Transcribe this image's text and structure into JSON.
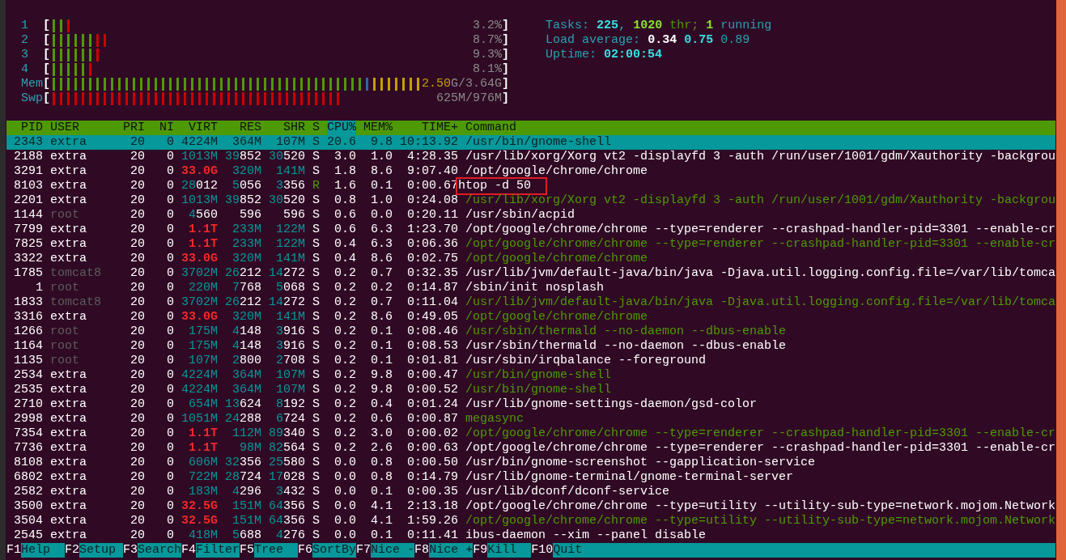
{
  "meters": [
    {
      "label": "1",
      "open": "[",
      "close": "]",
      "bars": [
        {
          "color": "#4e9a06"
        },
        {
          "color": "#4e9a06"
        },
        {
          "color": "#cc0000"
        }
      ],
      "reading": [
        {
          "text": "3.2%",
          "kind": "plain"
        }
      ]
    },
    {
      "label": "2",
      "open": "[",
      "close": "]",
      "bars": [
        {
          "color": "#4e9a06"
        },
        {
          "color": "#4e9a06"
        },
        {
          "color": "#4e9a06"
        },
        {
          "color": "#4e9a06"
        },
        {
          "color": "#4e9a06"
        },
        {
          "color": "#4e9a06"
        },
        {
          "color": "#cc0000"
        },
        {
          "color": "#cc0000"
        }
      ],
      "reading": [
        {
          "text": "8.7%",
          "kind": "plain"
        }
      ]
    },
    {
      "label": "3",
      "open": "[",
      "close": "]",
      "bars": [
        {
          "color": "#4e9a06"
        },
        {
          "color": "#4e9a06"
        },
        {
          "color": "#4e9a06"
        },
        {
          "color": "#4e9a06"
        },
        {
          "color": "#4e9a06"
        },
        {
          "color": "#4e9a06"
        },
        {
          "color": "#cc0000"
        }
      ],
      "reading": [
        {
          "text": "9.3%",
          "kind": "plain"
        }
      ]
    },
    {
      "label": "4",
      "open": "[",
      "close": "]",
      "bars": [
        {
          "color": "#4e9a06"
        },
        {
          "color": "#4e9a06"
        },
        {
          "color": "#4e9a06"
        },
        {
          "color": "#4e9a06"
        },
        {
          "color": "#4e9a06"
        },
        {
          "color": "#cc0000"
        }
      ],
      "reading": [
        {
          "text": "8.1%",
          "kind": "plain"
        }
      ]
    },
    {
      "label": "Mem",
      "open": "[",
      "close": "]",
      "bars": [
        {
          "color": "#4e9a06"
        },
        {
          "color": "#4e9a06"
        },
        {
          "color": "#4e9a06"
        },
        {
          "color": "#4e9a06"
        },
        {
          "color": "#4e9a06"
        },
        {
          "color": "#4e9a06"
        },
        {
          "color": "#4e9a06"
        },
        {
          "color": "#4e9a06"
        },
        {
          "color": "#4e9a06"
        },
        {
          "color": "#4e9a06"
        },
        {
          "color": "#4e9a06"
        },
        {
          "color": "#4e9a06"
        },
        {
          "color": "#4e9a06"
        },
        {
          "color": "#4e9a06"
        },
        {
          "color": "#4e9a06"
        },
        {
          "color": "#4e9a06"
        },
        {
          "color": "#4e9a06"
        },
        {
          "color": "#4e9a06"
        },
        {
          "color": "#4e9a06"
        },
        {
          "color": "#4e9a06"
        },
        {
          "color": "#4e9a06"
        },
        {
          "color": "#4e9a06"
        },
        {
          "color": "#4e9a06"
        },
        {
          "color": "#4e9a06"
        },
        {
          "color": "#4e9a06"
        },
        {
          "color": "#4e9a06"
        },
        {
          "color": "#4e9a06"
        },
        {
          "color": "#4e9a06"
        },
        {
          "color": "#4e9a06"
        },
        {
          "color": "#4e9a06"
        },
        {
          "color": "#4e9a06"
        },
        {
          "color": "#4e9a06"
        },
        {
          "color": "#4e9a06"
        },
        {
          "color": "#4e9a06"
        },
        {
          "color": "#4e9a06"
        },
        {
          "color": "#4e9a06"
        },
        {
          "color": "#4e9a06"
        },
        {
          "color": "#4e9a06"
        },
        {
          "color": "#4e9a06"
        },
        {
          "color": "#4e9a06"
        },
        {
          "color": "#4e9a06"
        },
        {
          "color": "#4e9a06"
        },
        {
          "color": "#4e9a06"
        },
        {
          "color": "#3465a4"
        },
        {
          "color": "#c4a000"
        },
        {
          "color": "#c4a000"
        },
        {
          "color": "#c4a000"
        },
        {
          "color": "#c4a000"
        },
        {
          "color": "#c4a000"
        },
        {
          "color": "#c4a000"
        },
        {
          "color": "#c4a000"
        }
      ],
      "reading": [
        {
          "text": "2.50",
          "kind": "used"
        },
        {
          "text": "G/3.64G",
          "kind": "plain"
        }
      ]
    },
    {
      "label": "Swp",
      "open": "[",
      "close": "]",
      "bars": [
        {
          "color": "#cc0000"
        },
        {
          "color": "#cc0000"
        },
        {
          "color": "#cc0000"
        },
        {
          "color": "#cc0000"
        },
        {
          "color": "#cc0000"
        },
        {
          "color": "#cc0000"
        },
        {
          "color": "#cc0000"
        },
        {
          "color": "#cc0000"
        },
        {
          "color": "#cc0000"
        },
        {
          "color": "#cc0000"
        },
        {
          "color": "#cc0000"
        },
        {
          "color": "#cc0000"
        },
        {
          "color": "#cc0000"
        },
        {
          "color": "#cc0000"
        },
        {
          "color": "#cc0000"
        },
        {
          "color": "#cc0000"
        },
        {
          "color": "#cc0000"
        },
        {
          "color": "#cc0000"
        },
        {
          "color": "#cc0000"
        },
        {
          "color": "#cc0000"
        },
        {
          "color": "#cc0000"
        },
        {
          "color": "#cc0000"
        },
        {
          "color": "#cc0000"
        },
        {
          "color": "#cc0000"
        },
        {
          "color": "#cc0000"
        },
        {
          "color": "#cc0000"
        },
        {
          "color": "#cc0000"
        },
        {
          "color": "#cc0000"
        },
        {
          "color": "#cc0000"
        },
        {
          "color": "#cc0000"
        },
        {
          "color": "#cc0000"
        },
        {
          "color": "#cc0000"
        },
        {
          "color": "#cc0000"
        },
        {
          "color": "#cc0000"
        },
        {
          "color": "#cc0000"
        },
        {
          "color": "#cc0000"
        },
        {
          "color": "#cc0000"
        },
        {
          "color": "#cc0000"
        },
        {
          "color": "#cc0000"
        },
        {
          "color": "#cc0000"
        }
      ],
      "reading": [
        {
          "text": "625M/976M",
          "kind": "plain"
        }
      ]
    }
  ],
  "summary": [
    [
      {
        "text": "Tasks: ",
        "kind": "label"
      },
      {
        "text": "225",
        "kind": "count"
      },
      {
        "text": ", ",
        "kind": "label"
      },
      {
        "text": "1020",
        "kind": "thread-count"
      },
      {
        "text": " thr; ",
        "kind": "thread"
      },
      {
        "text": "1",
        "kind": "thread-count"
      },
      {
        "text": " running",
        "kind": "label"
      }
    ],
    [
      {
        "text": "Load average: ",
        "kind": "label"
      },
      {
        "text": "0.34",
        "kind": "strong"
      },
      {
        "text": " 0.75",
        "kind": "count"
      },
      {
        "text": " 0.89",
        "kind": "label"
      }
    ],
    [
      {
        "text": "Uptime: ",
        "kind": "label"
      },
      {
        "text": "02:00:54",
        "kind": "count"
      }
    ]
  ],
  "columns": [
    {
      "label": "PID",
      "selected": false
    },
    {
      "label": "USER",
      "selected": false
    },
    {
      "label": "PRI",
      "selected": false
    },
    {
      "label": "NI",
      "selected": false
    },
    {
      "label": "VIRT",
      "selected": false
    },
    {
      "label": "RES",
      "selected": false
    },
    {
      "label": "SHR",
      "selected": false
    },
    {
      "label": "S",
      "selected": false
    },
    {
      "label": "CPU%",
      "selected": true
    },
    {
      "label": "MEM%",
      "selected": false
    },
    {
      "label": "TIME+",
      "selected": false
    },
    {
      "label": "Command",
      "selected": false
    }
  ],
  "processes": [
    {
      "pid": "2343",
      "user": "extra",
      "user_dimmed": false,
      "pri": "20",
      "ni": "0",
      "virt": {
        "hi": "4224M"
      },
      "res": {
        "hi": "364M"
      },
      "shr": {
        "hi": "107M"
      },
      "state": "S",
      "running": false,
      "cpu": "20.6",
      "mem": "9.8",
      "time": "10:13.92",
      "command": "/usr/bin/gnome-shell",
      "thread": false,
      "boxed": false,
      "selected": true
    },
    {
      "pid": "2188",
      "user": "extra",
      "user_dimmed": false,
      "pri": "20",
      "ni": "0",
      "virt": {
        "hi": "1013M"
      },
      "res": {
        "hi": "39",
        "lo": "852"
      },
      "shr": {
        "hi": "30",
        "lo": "520"
      },
      "state": "S",
      "running": false,
      "cpu": "3.0",
      "mem": "1.0",
      "time": "4:28.35",
      "command": "/usr/lib/xorg/Xorg vt2 -displayfd 3 -auth /run/user/1001/gdm/Xauthority -backgrou",
      "thread": false,
      "boxed": false,
      "selected": false
    },
    {
      "pid": "3291",
      "user": "extra",
      "user_dimmed": false,
      "pri": "20",
      "ni": "0",
      "virt": {
        "big": "33.0G"
      },
      "res": {
        "hi": "320M"
      },
      "shr": {
        "hi": "141M"
      },
      "state": "S",
      "running": false,
      "cpu": "1.8",
      "mem": "8.6",
      "time": "9:07.40",
      "command": "/opt/google/chrome/chrome",
      "thread": false,
      "boxed": false,
      "selected": false
    },
    {
      "pid": "8103",
      "user": "extra",
      "user_dimmed": false,
      "pri": "20",
      "ni": "0",
      "virt": {
        "hi": "28",
        "lo": "012"
      },
      "res": {
        "hi": "5",
        "lo": "056"
      },
      "shr": {
        "hi": "3",
        "lo": "356"
      },
      "state": "R",
      "running": true,
      "cpu": "1.6",
      "mem": "0.1",
      "time": "0:00.67",
      "command": "htop -d 50",
      "thread": false,
      "boxed": true,
      "selected": false
    },
    {
      "pid": "2201",
      "user": "extra",
      "user_dimmed": false,
      "pri": "20",
      "ni": "0",
      "virt": {
        "hi": "1013M"
      },
      "res": {
        "hi": "39",
        "lo": "852"
      },
      "shr": {
        "hi": "30",
        "lo": "520"
      },
      "state": "S",
      "running": false,
      "cpu": "0.8",
      "mem": "1.0",
      "time": "0:24.08",
      "command": "/usr/lib/xorg/Xorg vt2 -displayfd 3 -auth /run/user/1001/gdm/Xauthority -backgrou",
      "thread": true,
      "boxed": false,
      "selected": false
    },
    {
      "pid": "1144",
      "user": "root",
      "user_dimmed": true,
      "pri": "20",
      "ni": "0",
      "virt": {
        "hi": "4",
        "lo": "560"
      },
      "res": {
        "lo": "596"
      },
      "shr": {
        "lo": "596"
      },
      "state": "S",
      "running": false,
      "cpu": "0.6",
      "mem": "0.0",
      "time": "0:20.11",
      "command": "/usr/sbin/acpid",
      "thread": false,
      "boxed": false,
      "selected": false
    },
    {
      "pid": "7799",
      "user": "extra",
      "user_dimmed": false,
      "pri": "20",
      "ni": "0",
      "virt": {
        "big": "1.1T"
      },
      "res": {
        "hi": "233M"
      },
      "shr": {
        "hi": "122M"
      },
      "state": "S",
      "running": false,
      "cpu": "0.6",
      "mem": "6.3",
      "time": "1:23.70",
      "command": "/opt/google/chrome/chrome --type=renderer --crashpad-handler-pid=3301 --enable-cr",
      "thread": false,
      "boxed": false,
      "selected": false
    },
    {
      "pid": "7825",
      "user": "extra",
      "user_dimmed": false,
      "pri": "20",
      "ni": "0",
      "virt": {
        "big": "1.1T"
      },
      "res": {
        "hi": "233M"
      },
      "shr": {
        "hi": "122M"
      },
      "state": "S",
      "running": false,
      "cpu": "0.4",
      "mem": "6.3",
      "time": "0:06.36",
      "command": "/opt/google/chrome/chrome --type=renderer --crashpad-handler-pid=3301 --enable-cr",
      "thread": true,
      "boxed": false,
      "selected": false
    },
    {
      "pid": "3322",
      "user": "extra",
      "user_dimmed": false,
      "pri": "20",
      "ni": "0",
      "virt": {
        "big": "33.0G"
      },
      "res": {
        "hi": "320M"
      },
      "shr": {
        "hi": "141M"
      },
      "state": "S",
      "running": false,
      "cpu": "0.4",
      "mem": "8.6",
      "time": "0:02.75",
      "command": "/opt/google/chrome/chrome",
      "thread": true,
      "boxed": false,
      "selected": false
    },
    {
      "pid": "1785",
      "user": "tomcat8",
      "user_dimmed": true,
      "pri": "20",
      "ni": "0",
      "virt": {
        "hi": "3702M"
      },
      "res": {
        "hi": "26",
        "lo": "212"
      },
      "shr": {
        "hi": "14",
        "lo": "272"
      },
      "state": "S",
      "running": false,
      "cpu": "0.2",
      "mem": "0.7",
      "time": "0:32.35",
      "command": "/usr/lib/jvm/default-java/bin/java -Djava.util.logging.config.file=/var/lib/tomca",
      "thread": false,
      "boxed": false,
      "selected": false
    },
    {
      "pid": "1",
      "user": "root",
      "user_dimmed": true,
      "pri": "20",
      "ni": "0",
      "virt": {
        "hi": "220M"
      },
      "res": {
        "hi": "7",
        "lo": "768"
      },
      "shr": {
        "hi": "5",
        "lo": "068"
      },
      "state": "S",
      "running": false,
      "cpu": "0.2",
      "mem": "0.2",
      "time": "0:14.87",
      "command": "/sbin/init nosplash",
      "thread": false,
      "boxed": false,
      "selected": false
    },
    {
      "pid": "1833",
      "user": "tomcat8",
      "user_dimmed": true,
      "pri": "20",
      "ni": "0",
      "virt": {
        "hi": "3702M"
      },
      "res": {
        "hi": "26",
        "lo": "212"
      },
      "shr": {
        "hi": "14",
        "lo": "272"
      },
      "state": "S",
      "running": false,
      "cpu": "0.2",
      "mem": "0.7",
      "time": "0:11.04",
      "command": "/usr/lib/jvm/default-java/bin/java -Djava.util.logging.config.file=/var/lib/tomca",
      "thread": true,
      "boxed": false,
      "selected": false
    },
    {
      "pid": "3316",
      "user": "extra",
      "user_dimmed": false,
      "pri": "20",
      "ni": "0",
      "virt": {
        "big": "33.0G"
      },
      "res": {
        "hi": "320M"
      },
      "shr": {
        "hi": "141M"
      },
      "state": "S",
      "running": false,
      "cpu": "0.2",
      "mem": "8.6",
      "time": "0:49.05",
      "command": "/opt/google/chrome/chrome",
      "thread": true,
      "boxed": false,
      "selected": false
    },
    {
      "pid": "1266",
      "user": "root",
      "user_dimmed": true,
      "pri": "20",
      "ni": "0",
      "virt": {
        "hi": "175M"
      },
      "res": {
        "hi": "4",
        "lo": "148"
      },
      "shr": {
        "hi": "3",
        "lo": "916"
      },
      "state": "S",
      "running": false,
      "cpu": "0.2",
      "mem": "0.1",
      "time": "0:08.46",
      "command": "/usr/sbin/thermald --no-daemon --dbus-enable",
      "thread": true,
      "boxed": false,
      "selected": false
    },
    {
      "pid": "1164",
      "user": "root",
      "user_dimmed": true,
      "pri": "20",
      "ni": "0",
      "virt": {
        "hi": "175M"
      },
      "res": {
        "hi": "4",
        "lo": "148"
      },
      "shr": {
        "hi": "3",
        "lo": "916"
      },
      "state": "S",
      "running": false,
      "cpu": "0.2",
      "mem": "0.1",
      "time": "0:08.53",
      "command": "/usr/sbin/thermald --no-daemon --dbus-enable",
      "thread": false,
      "boxed": false,
      "selected": false
    },
    {
      "pid": "1135",
      "user": "root",
      "user_dimmed": true,
      "pri": "20",
      "ni": "0",
      "virt": {
        "hi": "107M"
      },
      "res": {
        "hi": "2",
        "lo": "800"
      },
      "shr": {
        "hi": "2",
        "lo": "708"
      },
      "state": "S",
      "running": false,
      "cpu": "0.2",
      "mem": "0.1",
      "time": "0:01.81",
      "command": "/usr/sbin/irqbalance --foreground",
      "thread": false,
      "boxed": false,
      "selected": false
    },
    {
      "pid": "2534",
      "user": "extra",
      "user_dimmed": false,
      "pri": "20",
      "ni": "0",
      "virt": {
        "hi": "4224M"
      },
      "res": {
        "hi": "364M"
      },
      "shr": {
        "hi": "107M"
      },
      "state": "S",
      "running": false,
      "cpu": "0.2",
      "mem": "9.8",
      "time": "0:00.47",
      "command": "/usr/bin/gnome-shell",
      "thread": true,
      "boxed": false,
      "selected": false
    },
    {
      "pid": "2535",
      "user": "extra",
      "user_dimmed": false,
      "pri": "20",
      "ni": "0",
      "virt": {
        "hi": "4224M"
      },
      "res": {
        "hi": "364M"
      },
      "shr": {
        "hi": "107M"
      },
      "state": "S",
      "running": false,
      "cpu": "0.2",
      "mem": "9.8",
      "time": "0:00.52",
      "command": "/usr/bin/gnome-shell",
      "thread": true,
      "boxed": false,
      "selected": false
    },
    {
      "pid": "2710",
      "user": "extra",
      "user_dimmed": false,
      "pri": "20",
      "ni": "0",
      "virt": {
        "hi": "654M"
      },
      "res": {
        "hi": "13",
        "lo": "624"
      },
      "shr": {
        "hi": "8",
        "lo": "192"
      },
      "state": "S",
      "running": false,
      "cpu": "0.2",
      "mem": "0.4",
      "time": "0:01.24",
      "command": "/usr/lib/gnome-settings-daemon/gsd-color",
      "thread": false,
      "boxed": false,
      "selected": false
    },
    {
      "pid": "2998",
      "user": "extra",
      "user_dimmed": false,
      "pri": "20",
      "ni": "0",
      "virt": {
        "hi": "1051M"
      },
      "res": {
        "hi": "24",
        "lo": "288"
      },
      "shr": {
        "hi": "6",
        "lo": "724"
      },
      "state": "S",
      "running": false,
      "cpu": "0.2",
      "mem": "0.6",
      "time": "0:00.87",
      "command": "megasync",
      "thread": true,
      "boxed": false,
      "selected": false
    },
    {
      "pid": "7354",
      "user": "extra",
      "user_dimmed": false,
      "pri": "20",
      "ni": "0",
      "virt": {
        "big": "1.1T"
      },
      "res": {
        "hi": "112M"
      },
      "shr": {
        "hi": "89",
        "lo": "340"
      },
      "state": "S",
      "running": false,
      "cpu": "0.2",
      "mem": "3.0",
      "time": "0:00.02",
      "command": "/opt/google/chrome/chrome --type=renderer --crashpad-handler-pid=3301 --enable-cr",
      "thread": true,
      "boxed": false,
      "selected": false
    },
    {
      "pid": "7736",
      "user": "extra",
      "user_dimmed": false,
      "pri": "20",
      "ni": "0",
      "virt": {
        "big": "1.1T"
      },
      "res": {
        "hi": "98M"
      },
      "shr": {
        "hi": "82",
        "lo": "564"
      },
      "state": "S",
      "running": false,
      "cpu": "0.2",
      "mem": "2.6",
      "time": "0:00.63",
      "command": "/opt/google/chrome/chrome --type=renderer --crashpad-handler-pid=3301 --enable-cr",
      "thread": false,
      "boxed": false,
      "selected": false
    },
    {
      "pid": "8108",
      "user": "extra",
      "user_dimmed": false,
      "pri": "20",
      "ni": "0",
      "virt": {
        "hi": "606M"
      },
      "res": {
        "hi": "32",
        "lo": "356"
      },
      "shr": {
        "hi": "25",
        "lo": "580"
      },
      "state": "S",
      "running": false,
      "cpu": "0.0",
      "mem": "0.8",
      "time": "0:00.50",
      "command": "/usr/bin/gnome-screenshot --gapplication-service",
      "thread": false,
      "boxed": false,
      "selected": false
    },
    {
      "pid": "6802",
      "user": "extra",
      "user_dimmed": false,
      "pri": "20",
      "ni": "0",
      "virt": {
        "hi": "722M"
      },
      "res": {
        "hi": "28",
        "lo": "724"
      },
      "shr": {
        "hi": "17",
        "lo": "028"
      },
      "state": "S",
      "running": false,
      "cpu": "0.0",
      "mem": "0.8",
      "time": "0:14.79",
      "command": "/usr/lib/gnome-terminal/gnome-terminal-server",
      "thread": false,
      "boxed": false,
      "selected": false
    },
    {
      "pid": "2582",
      "user": "extra",
      "user_dimmed": false,
      "pri": "20",
      "ni": "0",
      "virt": {
        "hi": "183M"
      },
      "res": {
        "hi": "4",
        "lo": "296"
      },
      "shr": {
        "hi": "3",
        "lo": "432"
      },
      "state": "S",
      "running": false,
      "cpu": "0.0",
      "mem": "0.1",
      "time": "0:00.35",
      "command": "/usr/lib/dconf/dconf-service",
      "thread": false,
      "boxed": false,
      "selected": false
    },
    {
      "pid": "3500",
      "user": "extra",
      "user_dimmed": false,
      "pri": "20",
      "ni": "0",
      "virt": {
        "big": "32.5G"
      },
      "res": {
        "hi": "151M"
      },
      "shr": {
        "hi": "64",
        "lo": "356"
      },
      "state": "S",
      "running": false,
      "cpu": "0.0",
      "mem": "4.1",
      "time": "2:13.18",
      "command": "/opt/google/chrome/chrome --type=utility --utility-sub-type=network.mojom.Network",
      "thread": false,
      "boxed": false,
      "selected": false
    },
    {
      "pid": "3504",
      "user": "extra",
      "user_dimmed": false,
      "pri": "20",
      "ni": "0",
      "virt": {
        "big": "32.5G"
      },
      "res": {
        "hi": "151M"
      },
      "shr": {
        "hi": "64",
        "lo": "356"
      },
      "state": "S",
      "running": false,
      "cpu": "0.0",
      "mem": "4.1",
      "time": "1:59.26",
      "command": "/opt/google/chrome/chrome --type=utility --utility-sub-type=network.mojom.Network",
      "thread": true,
      "boxed": false,
      "selected": false
    },
    {
      "pid": "2545",
      "user": "extra",
      "user_dimmed": false,
      "pri": "20",
      "ni": "0",
      "virt": {
        "hi": "418M"
      },
      "res": {
        "hi": "5",
        "lo": "688"
      },
      "shr": {
        "hi": "4",
        "lo": "276"
      },
      "state": "S",
      "running": false,
      "cpu": "0.0",
      "mem": "0.1",
      "time": "0:11.41",
      "command": "ibus-daemon --xim --panel disable",
      "thread": false,
      "boxed": false,
      "selected": false
    }
  ],
  "function_keys": [
    {
      "key": "F1",
      "label": "Help"
    },
    {
      "key": "F2",
      "label": "Setup"
    },
    {
      "key": "F3",
      "label": "Search"
    },
    {
      "key": "F4",
      "label": "Filter"
    },
    {
      "key": "F5",
      "label": "Tree"
    },
    {
      "key": "F6",
      "label": "SortBy"
    },
    {
      "key": "F7",
      "label": "Nice -"
    },
    {
      "key": "F8",
      "label": "Nice +"
    },
    {
      "key": "F9",
      "label": "Kill"
    },
    {
      "key": "F10",
      "label": "Quit"
    }
  ]
}
